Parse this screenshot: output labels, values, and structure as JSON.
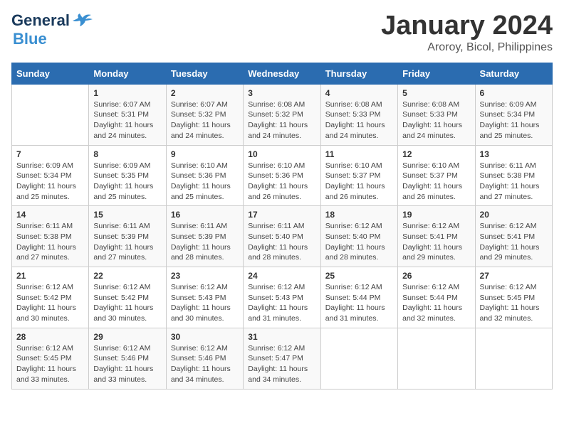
{
  "logo": {
    "line1": "General",
    "line2": "Blue"
  },
  "title": "January 2024",
  "subtitle": "Aroroy, Bicol, Philippines",
  "days_header": [
    "Sunday",
    "Monday",
    "Tuesday",
    "Wednesday",
    "Thursday",
    "Friday",
    "Saturday"
  ],
  "weeks": [
    [
      {
        "num": "",
        "info": ""
      },
      {
        "num": "1",
        "info": "Sunrise: 6:07 AM\nSunset: 5:31 PM\nDaylight: 11 hours\nand 24 minutes."
      },
      {
        "num": "2",
        "info": "Sunrise: 6:07 AM\nSunset: 5:32 PM\nDaylight: 11 hours\nand 24 minutes."
      },
      {
        "num": "3",
        "info": "Sunrise: 6:08 AM\nSunset: 5:32 PM\nDaylight: 11 hours\nand 24 minutes."
      },
      {
        "num": "4",
        "info": "Sunrise: 6:08 AM\nSunset: 5:33 PM\nDaylight: 11 hours\nand 24 minutes."
      },
      {
        "num": "5",
        "info": "Sunrise: 6:08 AM\nSunset: 5:33 PM\nDaylight: 11 hours\nand 24 minutes."
      },
      {
        "num": "6",
        "info": "Sunrise: 6:09 AM\nSunset: 5:34 PM\nDaylight: 11 hours\nand 25 minutes."
      }
    ],
    [
      {
        "num": "7",
        "info": "Sunrise: 6:09 AM\nSunset: 5:34 PM\nDaylight: 11 hours\nand 25 minutes."
      },
      {
        "num": "8",
        "info": "Sunrise: 6:09 AM\nSunset: 5:35 PM\nDaylight: 11 hours\nand 25 minutes."
      },
      {
        "num": "9",
        "info": "Sunrise: 6:10 AM\nSunset: 5:36 PM\nDaylight: 11 hours\nand 25 minutes."
      },
      {
        "num": "10",
        "info": "Sunrise: 6:10 AM\nSunset: 5:36 PM\nDaylight: 11 hours\nand 26 minutes."
      },
      {
        "num": "11",
        "info": "Sunrise: 6:10 AM\nSunset: 5:37 PM\nDaylight: 11 hours\nand 26 minutes."
      },
      {
        "num": "12",
        "info": "Sunrise: 6:10 AM\nSunset: 5:37 PM\nDaylight: 11 hours\nand 26 minutes."
      },
      {
        "num": "13",
        "info": "Sunrise: 6:11 AM\nSunset: 5:38 PM\nDaylight: 11 hours\nand 27 minutes."
      }
    ],
    [
      {
        "num": "14",
        "info": "Sunrise: 6:11 AM\nSunset: 5:38 PM\nDaylight: 11 hours\nand 27 minutes."
      },
      {
        "num": "15",
        "info": "Sunrise: 6:11 AM\nSunset: 5:39 PM\nDaylight: 11 hours\nand 27 minutes."
      },
      {
        "num": "16",
        "info": "Sunrise: 6:11 AM\nSunset: 5:39 PM\nDaylight: 11 hours\nand 28 minutes."
      },
      {
        "num": "17",
        "info": "Sunrise: 6:11 AM\nSunset: 5:40 PM\nDaylight: 11 hours\nand 28 minutes."
      },
      {
        "num": "18",
        "info": "Sunrise: 6:12 AM\nSunset: 5:40 PM\nDaylight: 11 hours\nand 28 minutes."
      },
      {
        "num": "19",
        "info": "Sunrise: 6:12 AM\nSunset: 5:41 PM\nDaylight: 11 hours\nand 29 minutes."
      },
      {
        "num": "20",
        "info": "Sunrise: 6:12 AM\nSunset: 5:41 PM\nDaylight: 11 hours\nand 29 minutes."
      }
    ],
    [
      {
        "num": "21",
        "info": "Sunrise: 6:12 AM\nSunset: 5:42 PM\nDaylight: 11 hours\nand 30 minutes."
      },
      {
        "num": "22",
        "info": "Sunrise: 6:12 AM\nSunset: 5:42 PM\nDaylight: 11 hours\nand 30 minutes."
      },
      {
        "num": "23",
        "info": "Sunrise: 6:12 AM\nSunset: 5:43 PM\nDaylight: 11 hours\nand 30 minutes."
      },
      {
        "num": "24",
        "info": "Sunrise: 6:12 AM\nSunset: 5:43 PM\nDaylight: 11 hours\nand 31 minutes."
      },
      {
        "num": "25",
        "info": "Sunrise: 6:12 AM\nSunset: 5:44 PM\nDaylight: 11 hours\nand 31 minutes."
      },
      {
        "num": "26",
        "info": "Sunrise: 6:12 AM\nSunset: 5:44 PM\nDaylight: 11 hours\nand 32 minutes."
      },
      {
        "num": "27",
        "info": "Sunrise: 6:12 AM\nSunset: 5:45 PM\nDaylight: 11 hours\nand 32 minutes."
      }
    ],
    [
      {
        "num": "28",
        "info": "Sunrise: 6:12 AM\nSunset: 5:45 PM\nDaylight: 11 hours\nand 33 minutes."
      },
      {
        "num": "29",
        "info": "Sunrise: 6:12 AM\nSunset: 5:46 PM\nDaylight: 11 hours\nand 33 minutes."
      },
      {
        "num": "30",
        "info": "Sunrise: 6:12 AM\nSunset: 5:46 PM\nDaylight: 11 hours\nand 34 minutes."
      },
      {
        "num": "31",
        "info": "Sunrise: 6:12 AM\nSunset: 5:47 PM\nDaylight: 11 hours\nand 34 minutes."
      },
      {
        "num": "",
        "info": ""
      },
      {
        "num": "",
        "info": ""
      },
      {
        "num": "",
        "info": ""
      }
    ]
  ]
}
